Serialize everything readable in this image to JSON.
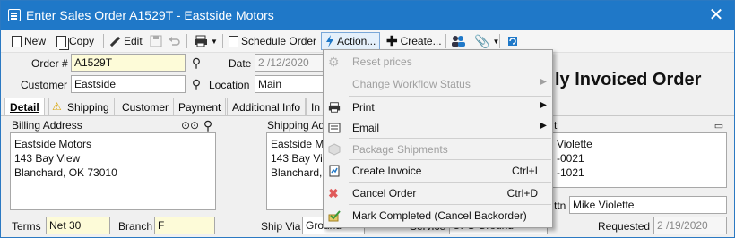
{
  "window": {
    "title": "Enter Sales Order A1529T - Eastside Motors",
    "close_glyph": "✕"
  },
  "toolbar": {
    "new_label": "New",
    "copy_label": "Copy",
    "edit_label": "Edit",
    "schedule_label": "Schedule Order",
    "action_label": "Action...",
    "create_label": "Create..."
  },
  "header": {
    "order_label": "Order #",
    "order_value": "A1529T",
    "date_label": "Date",
    "date_value": "2 /12/2020",
    "customer_label": "Customer",
    "customer_value": "Eastside",
    "location_label": "Location",
    "location_value": "Main",
    "status_title": "ly Invoiced Order"
  },
  "tabs": [
    "Detail",
    "Shipping",
    "Customer",
    "Payment",
    "Additional Info",
    "In"
  ],
  "billing": {
    "label": "Billing Address",
    "lines": "Eastside Motors\n143 Bay View\nBlanchard, OK 73010"
  },
  "shipping": {
    "label": "Shipping Ad",
    "lines": "Eastside M\n143 Bay Vi\nBlanchard,"
  },
  "contact": {
    "label": "t",
    "lines": "Violette\n-0021\n-1021",
    "attn_label": "ttn",
    "attn_value": "Mike Violette"
  },
  "footer": {
    "terms_label": "Terms",
    "terms_value": "Net 30",
    "branch_label": "Branch",
    "branch_value": "F",
    "shipvia_label": "Ship Via",
    "shipvia_value": "Ground",
    "service_label": "Service",
    "service_value": "UPS Ground",
    "requested_label": "Requested",
    "requested_value": "2 /19/2020"
  },
  "action_menu": {
    "items": [
      {
        "label": "Reset prices",
        "shortcut": "",
        "submenu": false,
        "disabled": true,
        "icon": "gear-icon"
      },
      {
        "label": "Change Workflow Status",
        "shortcut": "",
        "submenu": true,
        "disabled": true,
        "icon": ""
      },
      {
        "label": "Print",
        "shortcut": "",
        "submenu": true,
        "disabled": false,
        "icon": "printer-icon"
      },
      {
        "label": "Email",
        "shortcut": "",
        "submenu": true,
        "disabled": false,
        "icon": "email-icon"
      },
      {
        "label": "Package Shipments",
        "shortcut": "",
        "submenu": false,
        "disabled": true,
        "icon": "package-icon"
      },
      {
        "label": "Create Invoice",
        "shortcut": "Ctrl+I",
        "submenu": false,
        "disabled": false,
        "icon": "invoice-icon"
      },
      {
        "label": "Cancel Order",
        "shortcut": "Ctrl+D",
        "submenu": false,
        "disabled": false,
        "icon": "cancel-icon"
      },
      {
        "label": "Mark Completed (Cancel Backorder)",
        "shortcut": "",
        "submenu": false,
        "disabled": false,
        "icon": "check-icon"
      }
    ]
  },
  "colors": {
    "titlebar": "#1f78c8",
    "accent_yellow": "#fdfbd8",
    "cancel_red": "#e05a5a",
    "check_green": "#3a9a3a"
  }
}
